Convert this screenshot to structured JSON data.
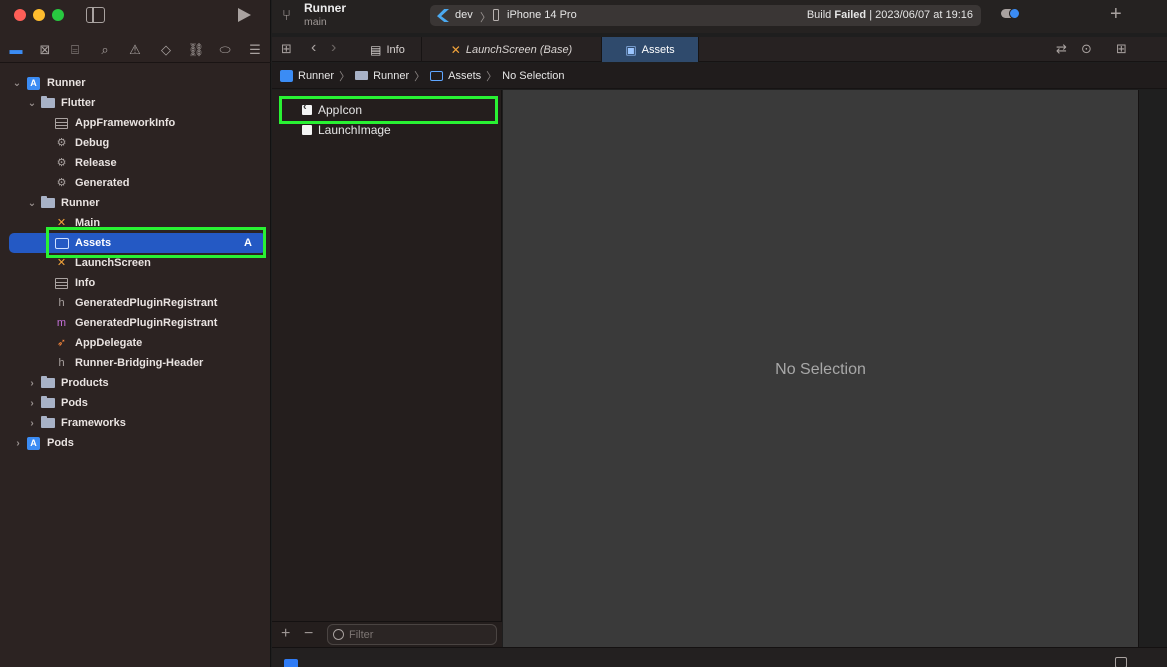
{
  "window": {
    "project": "Runner",
    "branch": "main"
  },
  "scheme": {
    "target": "dev",
    "device": "iPhone 14 Pro",
    "status_prefix": "Build ",
    "status_bold": "Failed",
    "status_suffix": " | 2023/06/07 at 19:16"
  },
  "navigator_tree": [
    {
      "label": "Runner",
      "icon": "project-icon"
    },
    {
      "label": "Flutter",
      "icon": "folder-icon"
    },
    {
      "label": "AppFrameworkInfo",
      "icon": "plist-icon"
    },
    {
      "label": "Debug",
      "icon": "xcconfig-icon"
    },
    {
      "label": "Release",
      "icon": "xcconfig-icon"
    },
    {
      "label": "Generated",
      "icon": "xcconfig-icon"
    },
    {
      "label": "Runner",
      "icon": "folder-icon"
    },
    {
      "label": "Main",
      "icon": "storyboard-icon"
    },
    {
      "label": "Assets",
      "icon": "assets-icon",
      "badge": "A",
      "selected": true
    },
    {
      "label": "LaunchScreen",
      "icon": "storyboard-icon"
    },
    {
      "label": "Info",
      "icon": "plist-icon"
    },
    {
      "label": "GeneratedPluginRegistrant",
      "icon": "header-h-icon"
    },
    {
      "label": "GeneratedPluginRegistrant",
      "icon": "objc-m-icon"
    },
    {
      "label": "AppDelegate",
      "icon": "swift-icon"
    },
    {
      "label": "Runner-Bridging-Header",
      "icon": "header-h-icon"
    },
    {
      "label": "Products",
      "icon": "folder-icon"
    },
    {
      "label": "Pods",
      "icon": "folder-icon"
    },
    {
      "label": "Frameworks",
      "icon": "folder-icon"
    },
    {
      "label": "Pods",
      "icon": "project-icon"
    }
  ],
  "tabs": [
    {
      "label": "Info",
      "icon": "plist-icon"
    },
    {
      "label": "LaunchScreen (Base)",
      "icon": "storyboard-icon"
    },
    {
      "label": "Assets",
      "icon": "assets-icon",
      "active": true
    }
  ],
  "breadcrumb": [
    "Runner",
    "Runner",
    "Assets",
    "No Selection"
  ],
  "assets": [
    "AppIcon",
    "LaunchImage"
  ],
  "asset_filter": {
    "placeholder": "Filter"
  },
  "detail": {
    "empty_text": "No Selection"
  },
  "colors": {
    "accent": "#3b8cf4",
    "selection": "#2459c4",
    "highlight_box": "#29f233"
  }
}
